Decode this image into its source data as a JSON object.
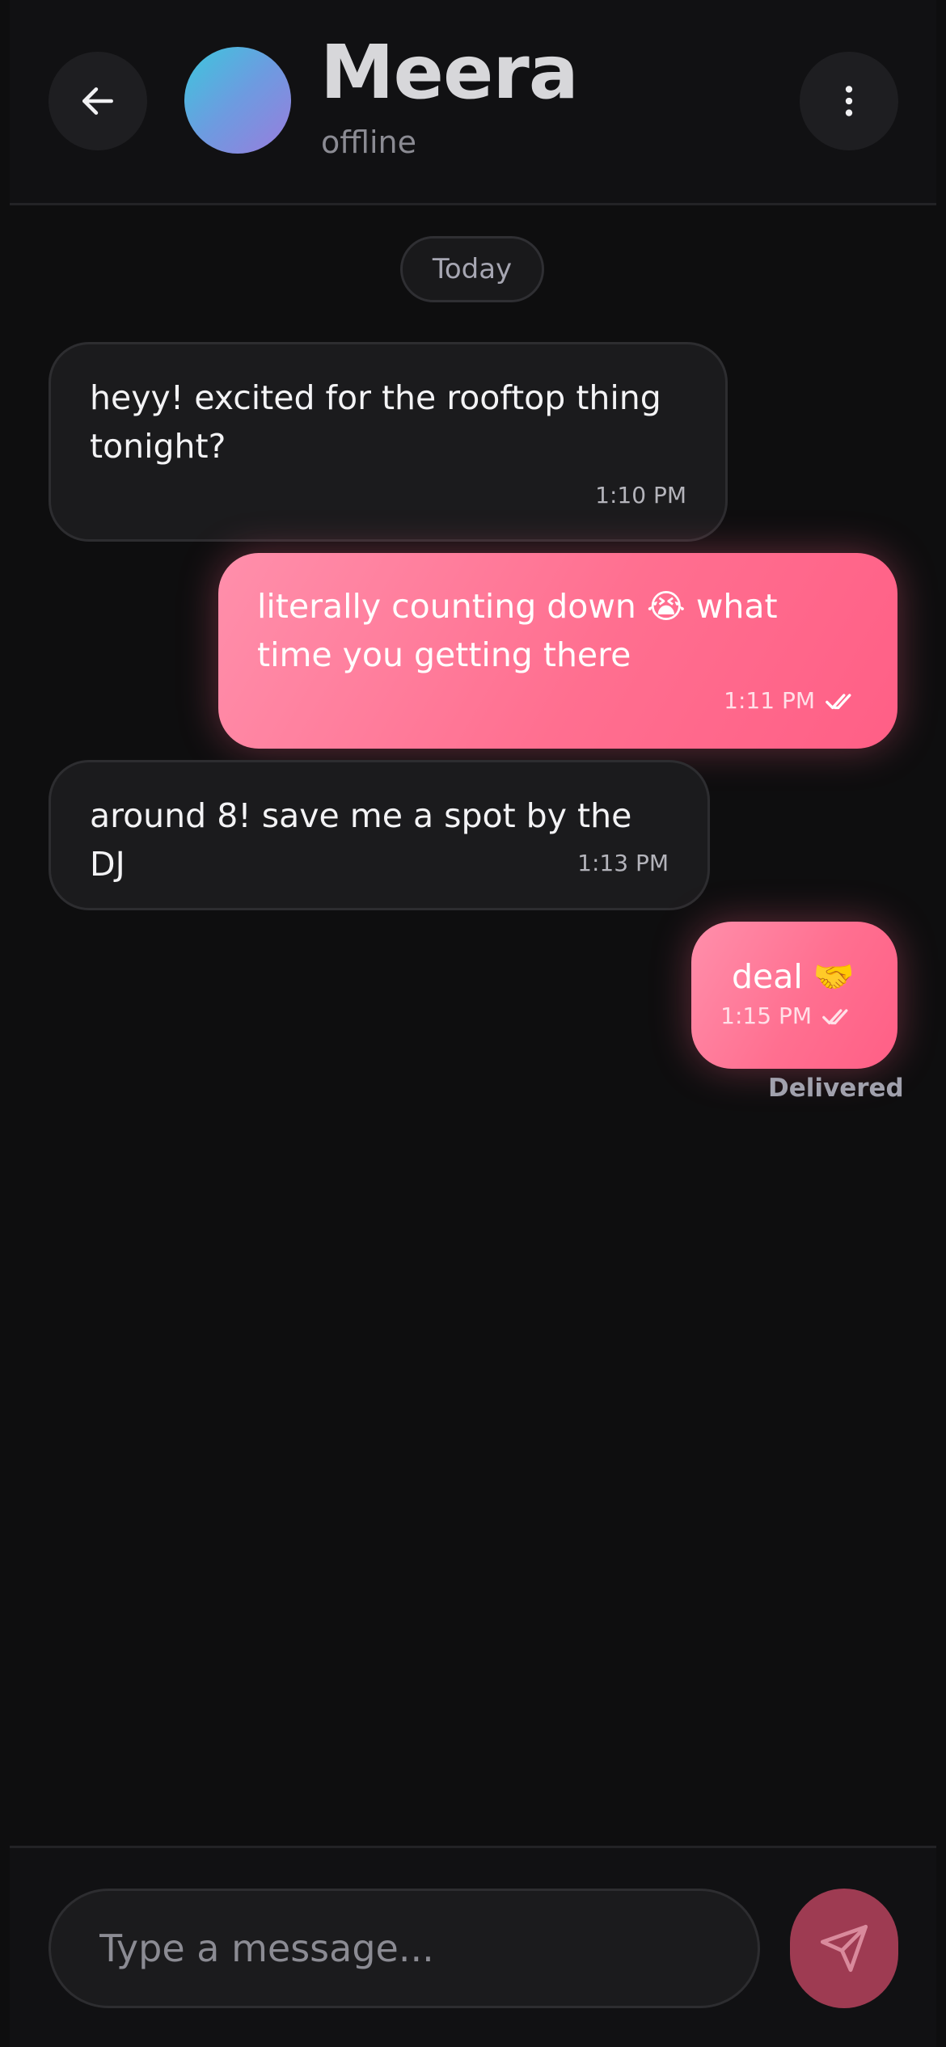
{
  "header": {
    "name": "Meera",
    "status": "offline",
    "avatar_gradient": [
      "#3cc7dd",
      "#9a7cdd"
    ],
    "back_icon": "arrow-left-icon",
    "more_icon": "more-vertical-icon"
  },
  "date_chip": "Today",
  "messages": [
    {
      "direction": "in",
      "text": "heyy! excited for the rooftop thing tonight?",
      "time": "1:10 PM"
    },
    {
      "direction": "out",
      "text": "literally counting down 😭 what time you getting there",
      "time": "1:11 PM",
      "ticks": "double-check-icon"
    },
    {
      "direction": "in",
      "text": "around 8! save me a spot by the DJ",
      "time": "1:13 PM"
    },
    {
      "direction": "out",
      "text": "deal 🤝",
      "time": "1:15 PM",
      "ticks": "double-check-icon"
    }
  ],
  "delivery_status": "Delivered",
  "composer": {
    "placeholder": "Type a message...",
    "send_icon": "send-icon"
  },
  "colors": {
    "background": "#0e0e0f",
    "incoming_bubble": "#1b1b1d",
    "outgoing_bubble": "#ff6f90",
    "send_button": "#9e3b52"
  }
}
